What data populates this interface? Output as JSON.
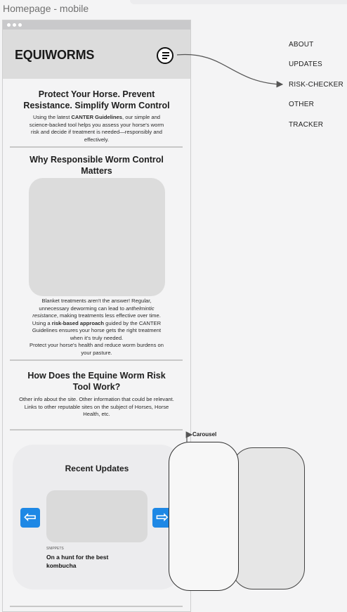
{
  "frame": {
    "title": "Homepage - mobile"
  },
  "header": {
    "brand": "EQUIWORMS"
  },
  "hero": {
    "title_line1": "Protect Your Horse. Prevent",
    "title_line2": "Resistance. Simplify Worm Control",
    "body_pre": "Using the latest ",
    "body_bold": "CANTER Guidelines",
    "body_post": ", our simple and science-backed tool helps you assess your horse's worm risk and decide if treatment is needed—responsibly and effectively."
  },
  "why": {
    "title_line1": "Why Responsible Worm Control",
    "title_line2": "Matters",
    "p1_pre": "Blanket treatments aren't the answer! Regular, unnecessary deworming can lead to ",
    "p1_em": "anthelmintic resistance",
    "p1_post": ", making treatments less effective over time.",
    "p2_pre": "Using a ",
    "p2_bold": "risk-based approach",
    "p2_post": " guided by the CANTER Guidelines ensures your horse gets the right treatment when it's truly needed.",
    "p3": "Protect your horse's health and reduce worm burdens on your pasture."
  },
  "how": {
    "title_line1": "How Does the Equine Worm Risk",
    "title_line2": "Tool Work?",
    "body": "Other info about the site. Other information that could be relevant. Links to other reputable sites on the subject of Horses, Horse Health, etc."
  },
  "updates": {
    "title": "Recent Updates",
    "meta": "SNIPPETS",
    "post_title": "On a hunt for the best kombucha",
    "prev_icon": "arrow-left-icon",
    "next_icon": "arrow-right-icon",
    "prev_glyph": "⇦",
    "next_glyph": "⇨"
  },
  "nav_menu": [
    "ABOUT",
    "UPDATES",
    "RISK-CHECKER",
    "OTHER",
    "TRACKER"
  ],
  "annotations": {
    "carousel": "Carousel"
  },
  "colors": {
    "accent": "#1e88e5",
    "header_bg": "#dcdcdc",
    "placeholder": "#dcdcdc"
  }
}
